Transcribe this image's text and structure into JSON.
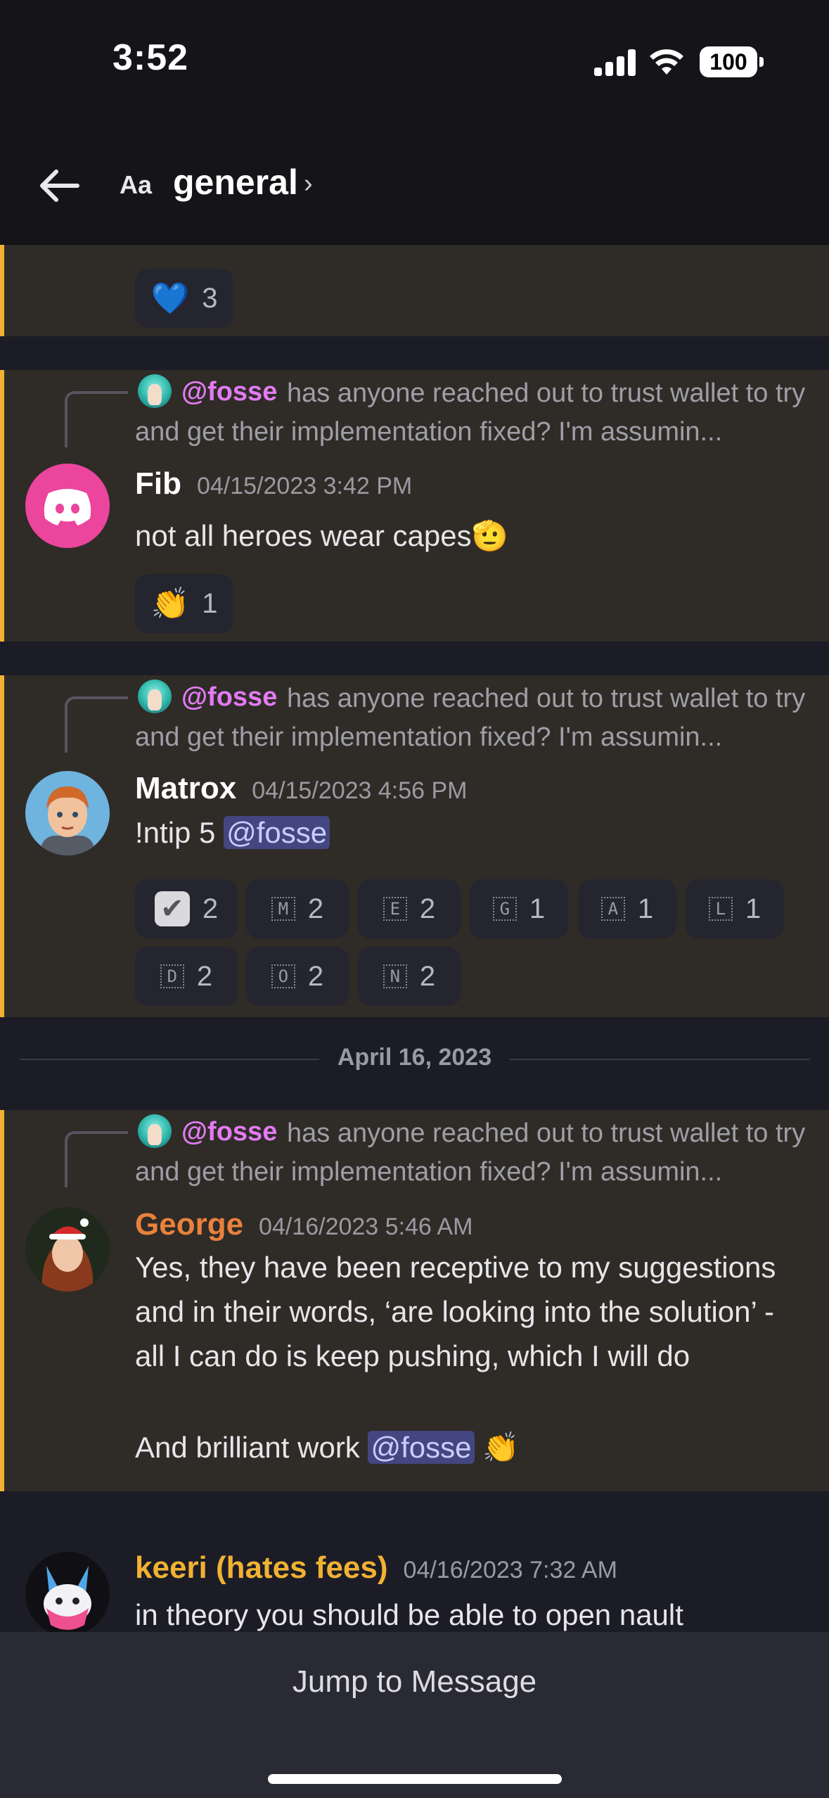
{
  "status_bar": {
    "time": "3:52",
    "battery": "100"
  },
  "header": {
    "aa_label": "Aa",
    "channel": "general",
    "chevron": "›"
  },
  "messages": [
    {
      "reactions": [
        {
          "emoji": "💙",
          "count": "3"
        }
      ]
    },
    {
      "reply": {
        "mention": "@fosse",
        "text": "has anyone reached out to trust wallet to try and get their implementation fixed? I'm assumin..."
      },
      "author": "Fib",
      "author_color": "#ffffff",
      "timestamp": "04/15/2023 3:42 PM",
      "content": "not all heroes wear capes",
      "content_emoji": "🫡",
      "reactions": [
        {
          "emoji": "👏",
          "count": "1"
        }
      ]
    },
    {
      "reply": {
        "mention": "@fosse",
        "text": "has anyone reached out to trust wallet to try and get their implementation fixed? I'm assumin..."
      },
      "author": "Matrox",
      "author_color": "#ffffff",
      "timestamp": "04/15/2023 4:56 PM",
      "content_prefix": "!ntip 5",
      "content_mention": "@fosse",
      "reactions": [
        {
          "emoji": "✔",
          "count": "2"
        },
        {
          "letter": "M",
          "count": "2"
        },
        {
          "letter": "E",
          "count": "2"
        },
        {
          "letter": "G",
          "count": "1"
        },
        {
          "letter": "A",
          "count": "1"
        },
        {
          "letter": "L",
          "count": "1"
        },
        {
          "letter": "D",
          "count": "2"
        },
        {
          "letter": "O",
          "count": "2"
        },
        {
          "letter": "N",
          "count": "2"
        }
      ]
    },
    {
      "reply": {
        "mention": "@fosse",
        "text": "has anyone reached out to trust wallet to try and get their implementation fixed? I'm assumin..."
      },
      "author": "George",
      "author_color": "#e9813c",
      "timestamp": "04/16/2023 5:46 AM",
      "content": "Yes, they have been receptive to my suggestions and in their words, ‘are looking into the solution’ - all I can do is keep pushing, which I will do",
      "content2_prefix": "And brilliant work",
      "content2_mention": "@fosse",
      "content2_emoji": "👏"
    },
    {
      "author": "keeri (hates fees)",
      "author_color": "#f0b232",
      "timestamp": "04/16/2023 7:32 AM",
      "content": "in theory you should be able to open nault"
    }
  ],
  "date_divider": "April 16, 2023",
  "footer": {
    "jump_label": "Jump to Message"
  },
  "icons": {
    "back": "arrow-left-icon",
    "discord": "discord-logo-icon"
  },
  "colors": {
    "highlight_bar": "#f0b232",
    "mention_bg": "#434680",
    "reply_mention": "#e27bf2",
    "discord_pink": "#eb459e"
  }
}
